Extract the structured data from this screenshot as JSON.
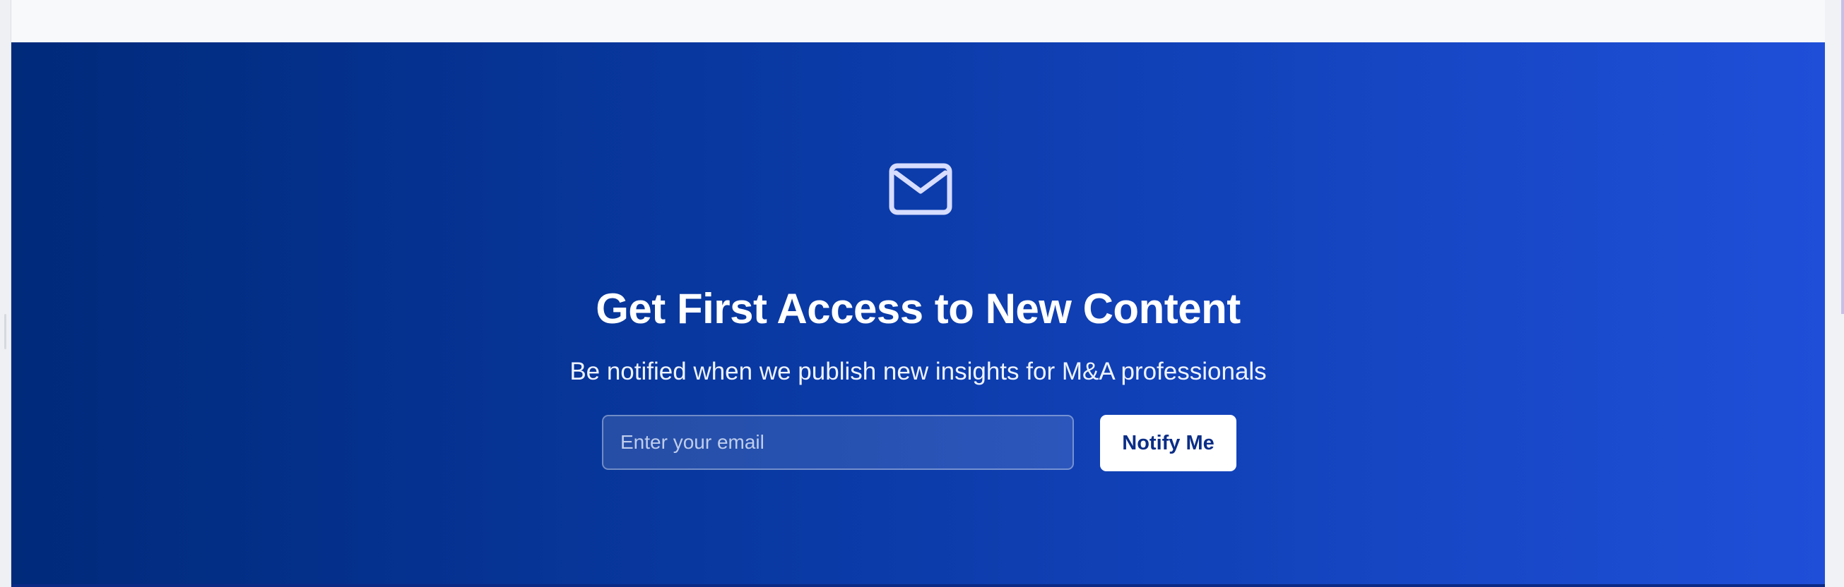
{
  "hero": {
    "icon": "mail-icon",
    "title": "Get First Access to New Content",
    "subtitle": "Be notified when we publish new insights for M&A professionals",
    "email": {
      "placeholder": "Enter your email",
      "value": ""
    },
    "button_label": "Notify Me"
  },
  "colors": {
    "gradient_start": "#002a7a",
    "gradient_mid": "#0a3aa6",
    "gradient_end": "#1f4fd8",
    "button_bg": "#ffffff",
    "button_text": "#0a2d86"
  }
}
